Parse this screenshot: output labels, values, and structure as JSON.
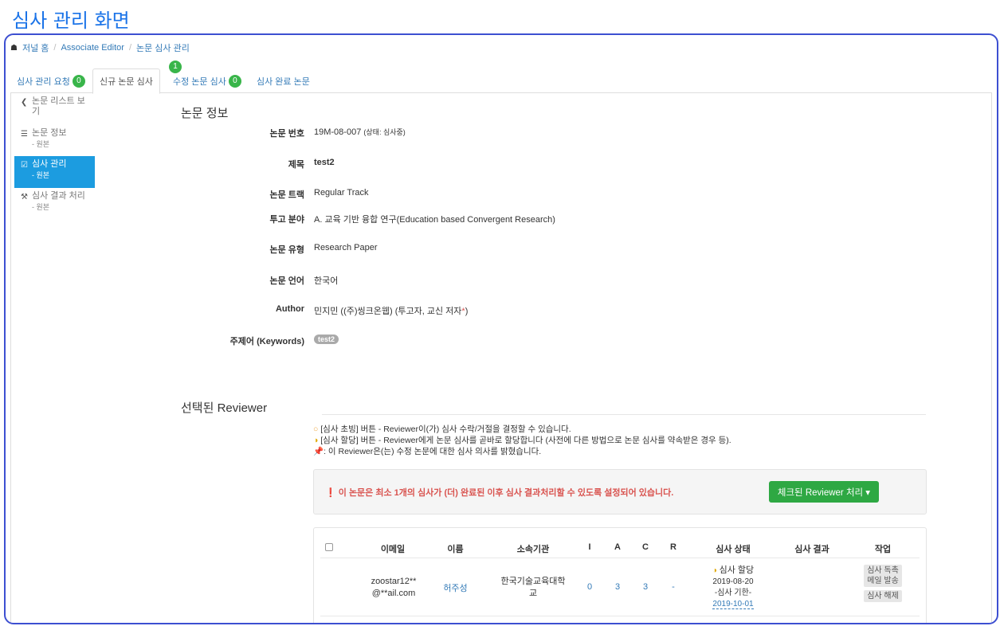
{
  "page_title": "심사 관리 화면",
  "breadcrumb": {
    "items": [
      "저널 홈",
      "Associate Editor",
      "논문 심사 관리"
    ]
  },
  "tabs": [
    {
      "label": "심사 관리 요청",
      "badge": "0"
    },
    {
      "label": "신규 논문 심사",
      "badge": "1"
    },
    {
      "label": "수정 논문 심사",
      "badge": "0"
    },
    {
      "label": "심사 완료 논문"
    }
  ],
  "sidebar": {
    "items": [
      {
        "label": "논문 리스트 보기",
        "sub": ""
      },
      {
        "label": "논문 정보",
        "sub": "- 원본"
      },
      {
        "label": "심사 관리",
        "sub": "- 원본"
      },
      {
        "label": "심사 결과 처리",
        "sub": "- 원본"
      }
    ]
  },
  "paper_info": {
    "title": "논문 정보",
    "number_label": "논문 번호",
    "number": "19M-08-007",
    "status": "(상태: 심사중)",
    "title_label": "제목",
    "title_value": "test2",
    "track_label": "논문 트랙",
    "track": "Regular Track",
    "field_label": "투고 분야",
    "field": "A. 교육 기반 융합 연구(Education based Convergent Research)",
    "type_label": "논문 유형",
    "type": "Research Paper",
    "language_label": "논문 언어",
    "language": "한국어",
    "author_label": "Author",
    "author": "민지민 ((주)씽크온웹) (투고자, 교신 저자",
    "author_star": "*",
    "author_close": ")",
    "keywords_label": "주제어 (Keywords)",
    "keyword": "test2"
  },
  "reviewer": {
    "title": "선택된 Reviewer",
    "legend": [
      "[심사 초빙] 버튼 - Reviewer이(가) 심사 수락/거절을 결정할 수 있습니다.",
      "[심사 할당] 버튼 - Reviewer에게 논문 심사를 곧바로 할당합니다 (사전에 다른 방법으로 논문 심사를 약속받은 경우 등).",
      ": 이 Reviewer은(는) 수정 논문에 대한 심사 의사를 밝혔습니다."
    ],
    "alert": "이 논문은 최소 1개의 심사가 (더) 완료된 이후 심사 결과처리할 수 있도록 설정되어 있습니다.",
    "action_button": "체크된 Reviewer 처리 ▾",
    "columns": [
      "이메일",
      "이름",
      "소속기관",
      "I",
      "A",
      "C",
      "R",
      "심사 상태",
      "심사 결과",
      "작업"
    ],
    "rows": [
      {
        "email_1": "zoostar12**",
        "email_2": "@**ail.com",
        "name": "허주성",
        "org_1": "한국기술교육대학",
        "org_2": "교",
        "i": "0",
        "a": "3",
        "c": "3",
        "r": "-",
        "state": "심사 할당",
        "date": "2019-08-20",
        "deadline_label": "-심사 기한-",
        "deadline": "2019-10-01",
        "result": "",
        "btn_remind_1": "심사 독촉",
        "btn_remind_2": "메일 발송",
        "btn_cancel": "심사 해제"
      }
    ]
  },
  "colors": {
    "accent": "#1c9ce0",
    "brand_title": "#1a73e8",
    "frame": "#3d4fd1",
    "success": "#2ea843",
    "danger": "#d9534f"
  }
}
